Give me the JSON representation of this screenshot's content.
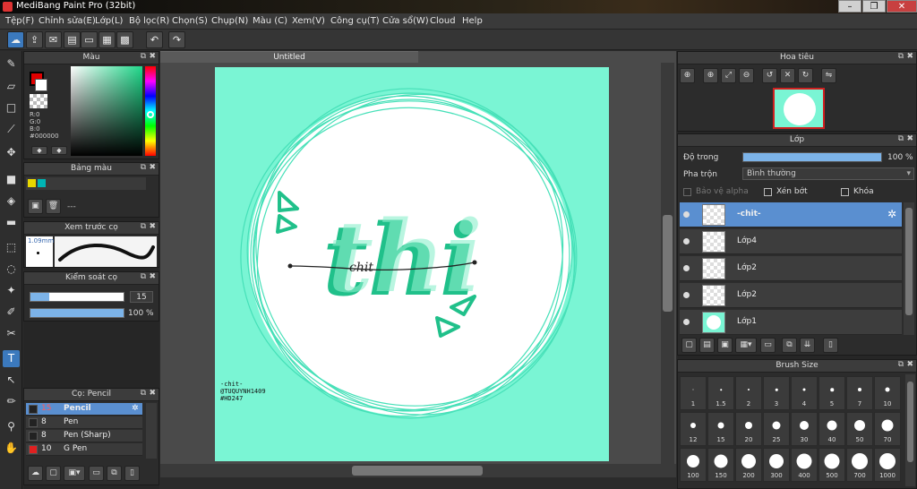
{
  "window": {
    "title": "MediBang Paint Pro (32bit)",
    "controls": [
      "–",
      "❐",
      "✕"
    ]
  },
  "menu": [
    "Tệp(F)",
    "Chỉnh sửa(E)",
    "Lớp(L)",
    "Bộ lọc(R)",
    "Chọn(S)",
    "Chụp(N)",
    "Màu (C)",
    "Xem(V)",
    "Công cụ(T)",
    "Cửa sổ(W)",
    "Cloud",
    "Help"
  ],
  "document": {
    "tab": "Untitled",
    "signature": [
      "-chit-",
      "@TUQUYNH1409",
      "#HD247"
    ],
    "lettering": "thi",
    "cursive": "chit"
  },
  "color_panel": {
    "title": "Màu",
    "readout": [
      "R:0",
      "G:0",
      "B:0",
      "#000000"
    ],
    "foreground": "#e00000",
    "background": "#ffffff"
  },
  "palette_panel": {
    "title": "Bảng màu",
    "swatches": [
      "#e8d800",
      "#00b4b4"
    ],
    "dash": "---"
  },
  "brush_preview": {
    "title": "Xem trước cọ",
    "size": "1.09mm"
  },
  "brush_control": {
    "title": "Kiểm soát cọ",
    "size": "15",
    "opacity": "100 %",
    "size_fill": 0.2,
    "opacity_fill": 1.0
  },
  "brush_list": {
    "title": "Cọ: Pencil",
    "items": [
      {
        "size": "15",
        "name": "Pencil",
        "swatch": "#333333",
        "selected": true
      },
      {
        "size": "8",
        "name": "Pen",
        "swatch": "#333333",
        "selected": false
      },
      {
        "size": "8",
        "name": "Pen (Sharp)",
        "swatch": "#333333",
        "selected": false
      },
      {
        "size": "10",
        "name": "G Pen",
        "swatch": "#e02020",
        "selected": false
      }
    ]
  },
  "navigator": {
    "title": "Hoa tiêu"
  },
  "layer_panel": {
    "title": "Lớp",
    "opacity_label": "Độ trong",
    "opacity_value": "100 %",
    "blend_label": "Pha trộn",
    "blend_value": "Bình thường",
    "protect_alpha": "Bảo vệ alpha",
    "clipping": "Xén bớt",
    "lock": "Khóa",
    "layers": [
      {
        "name": "-chit-",
        "selected": true
      },
      {
        "name": "Lớp4",
        "selected": false
      },
      {
        "name": "Lớp2",
        "selected": false
      },
      {
        "name": "Lớp2",
        "selected": false
      },
      {
        "name": "Lớp1",
        "selected": false
      }
    ]
  },
  "brush_size_panel": {
    "title": "Brush Size",
    "sizes": [
      "1",
      "1.5",
      "2",
      "3",
      "4",
      "5",
      "7",
      "10",
      "12",
      "15",
      "20",
      "25",
      "30",
      "40",
      "50",
      "70",
      "100",
      "150",
      "200",
      "300",
      "400",
      "500",
      "700",
      "1000"
    ]
  },
  "colors": {
    "canvas_bg": "#7af5d4",
    "accent": "#5a8fd0",
    "lettering": "#20c08a"
  }
}
